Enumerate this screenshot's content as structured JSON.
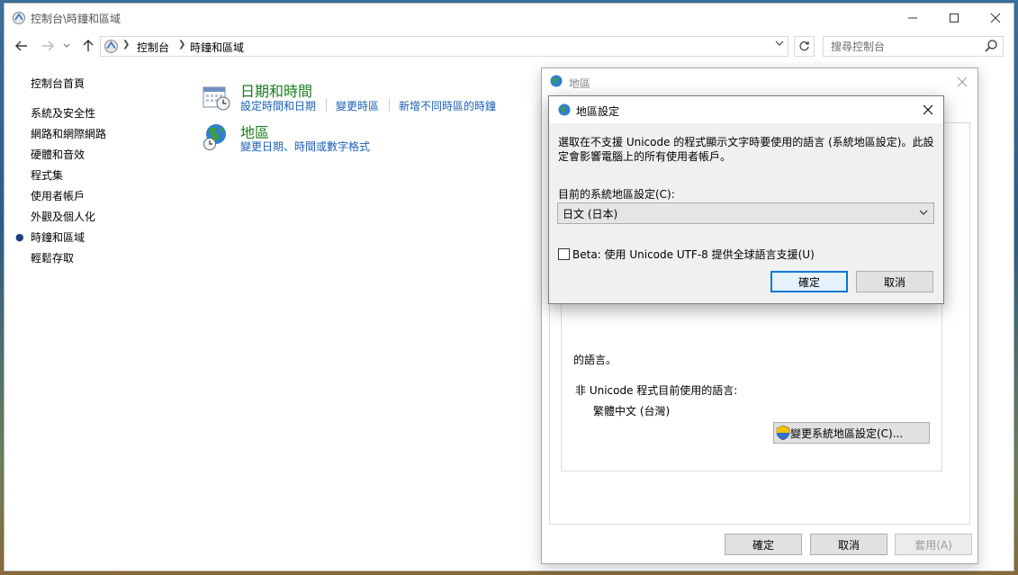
{
  "window": {
    "title": "控制台\\時鐘和區域"
  },
  "address": {
    "crumbs": [
      "控制台",
      "時鐘和區域"
    ],
    "search_placeholder": "搜尋控制台"
  },
  "left_nav": {
    "home": "控制台首頁",
    "items": [
      "系統及安全性",
      "網路和網際網路",
      "硬體和音效",
      "程式集",
      "使用者帳戶",
      "外觀及個人化",
      "時鐘和區域",
      "輕鬆存取"
    ],
    "selected_index": 6
  },
  "categories": [
    {
      "title": "日期和時間",
      "links": [
        "設定時間和日期",
        "變更時區",
        "新增不同時區的時鐘"
      ],
      "icon": "calendar-clock-icon"
    },
    {
      "title": "地區",
      "links": [
        "變更日期、時間或數字格式"
      ],
      "icon": "globe-clock-icon"
    }
  ],
  "region_dialog": {
    "title": "地區",
    "partial_text": "的語言。",
    "nonunicode_label": "非 Unicode 程式目前使用的語言:",
    "nonunicode_value": "繁體中文 (台灣)",
    "change_locale_button": "變更系統地區設定(C)...",
    "ok": "確定",
    "cancel": "取消",
    "apply": "套用(A)"
  },
  "settings_dialog": {
    "title": "地區設定",
    "description": "選取在不支援 Unicode 的程式顯示文字時要使用的語言 (系統地區設定)。此設定會影響電腦上的所有使用者帳戶。",
    "current_label": "目前的系統地區設定(C):",
    "current_value": "日文 (日本)",
    "beta_label": "Beta: 使用 Unicode UTF-8 提供全球語言支援(U)",
    "beta_checked": false,
    "ok": "確定",
    "cancel": "取消"
  },
  "colors": {
    "category_title": "#1e7b1e",
    "link": "#1a5fb4",
    "default_button_border": "#0078d7"
  }
}
